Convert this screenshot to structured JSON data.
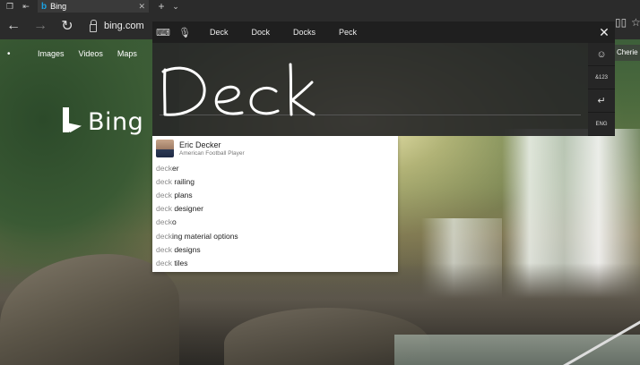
{
  "tabbar": {
    "active_tab": {
      "title": "Bing"
    }
  },
  "addressbar": {
    "url": "bing.com"
  },
  "bing": {
    "nav": [
      "Images",
      "Videos",
      "Maps"
    ],
    "logo_text": "Bing",
    "right_peek": "Cherie"
  },
  "handwriting": {
    "candidates": [
      "Deck",
      "Dock",
      "Docks",
      "Peck"
    ],
    "ink_word": "Deck",
    "side_keys": {
      "emoji": "☺",
      "symbols": "&123",
      "enter": "↵",
      "language": "ENG"
    }
  },
  "suggestions": {
    "entity": {
      "name": "Eric Decker",
      "description": "American Football Player"
    },
    "items": [
      {
        "prefix": "deck",
        "rest": "er"
      },
      {
        "prefix": "deck",
        "rest": " railing"
      },
      {
        "prefix": "deck",
        "rest": " plans"
      },
      {
        "prefix": "deck",
        "rest": " designer"
      },
      {
        "prefix": "deck",
        "rest": "o"
      },
      {
        "prefix": "deck",
        "rest": "ing material options"
      },
      {
        "prefix": "deck",
        "rest": " designs"
      },
      {
        "prefix": "deck",
        "rest": " tiles"
      }
    ]
  }
}
